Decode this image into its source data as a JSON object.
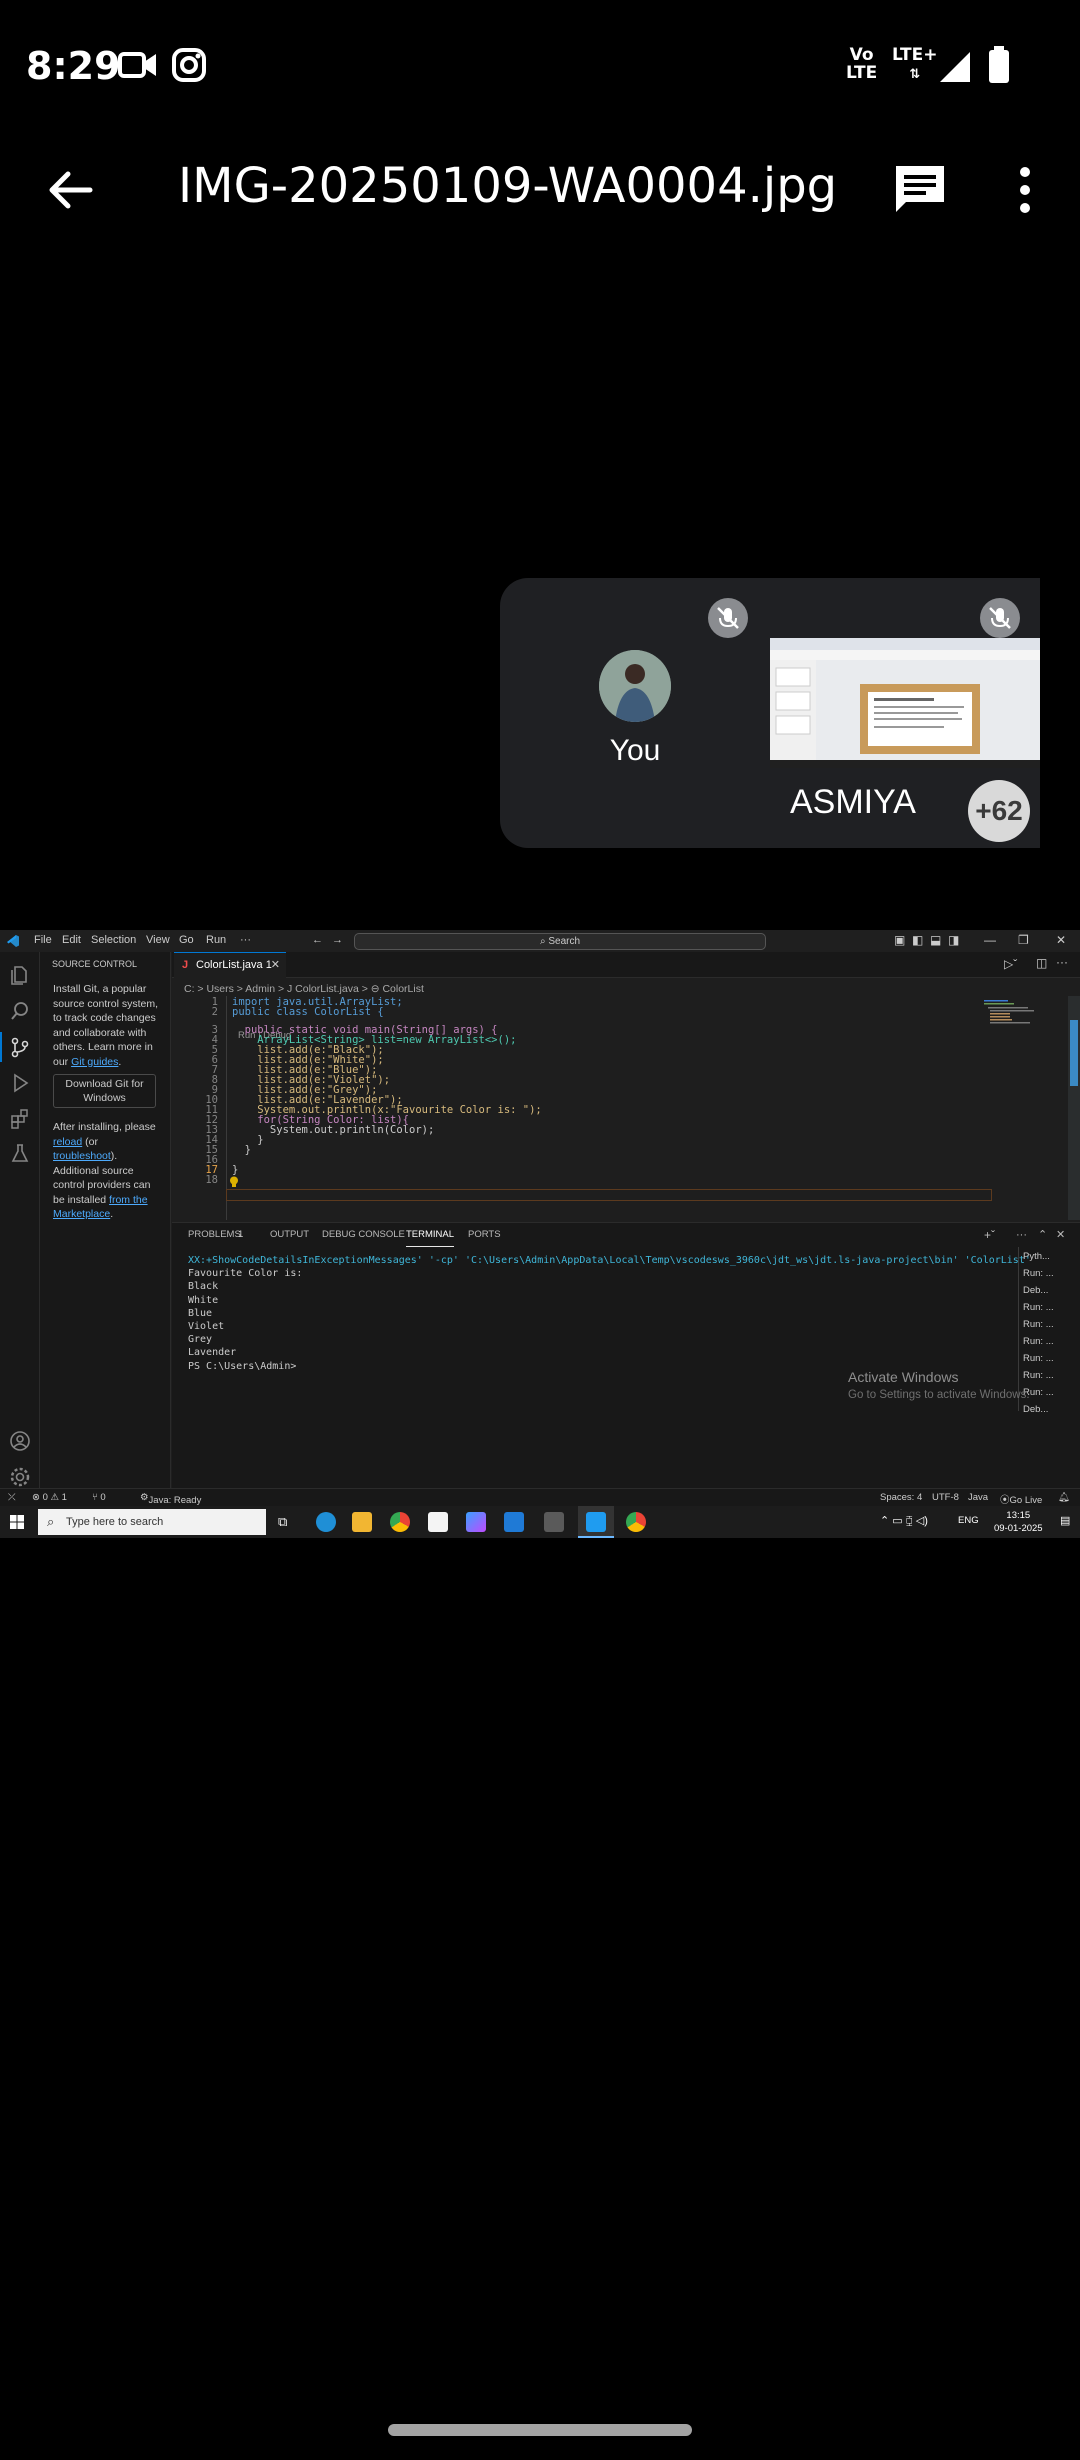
{
  "status_bar": {
    "time": "8:29",
    "net1": "Vo\nLTE",
    "net2": "LTE+"
  },
  "toolbar": {
    "title": "IMG-20250109-WA0004.jpg"
  },
  "meet": {
    "self_name": "You",
    "other_name": "ASMIYA",
    "more_count": "+62"
  },
  "vscode": {
    "menu": [
      "File",
      "Edit",
      "Selection",
      "View",
      "Go",
      "Run",
      "···"
    ],
    "search": "Search",
    "sidebar": {
      "header": "SOURCE CONTROL",
      "intro_a": "Install Git, a popular source control system, to track code changes and collaborate with others. Learn more in our ",
      "intro_link": "Git guides",
      "intro_b": ".",
      "download_button": "Download Git for Windows",
      "after_a": "After installing, please ",
      "after_link1": "reload",
      "after_b": " (or ",
      "after_link2": "troubleshoot",
      "after_c": "). Additional source control providers can be installed ",
      "after_link3": "from the Marketplace",
      "after_d": "."
    },
    "tab_label": "ColorList.java 1",
    "breadcrumb": "C: > Users > Admin > J ColorList.java > ⊖ ColorList",
    "codelens": "Run | Debug",
    "lines": [
      {
        "n": "1",
        "code": "import java.util.ArrayList;"
      },
      {
        "n": "2",
        "code": "public class ColorList {"
      },
      {
        "n": "3",
        "code": "  public static void main(String[] args) {"
      },
      {
        "n": "4",
        "code": "    ArrayList<String> list=new ArrayList<>();"
      },
      {
        "n": "5",
        "code": "    list.add(e:\"Black\");"
      },
      {
        "n": "6",
        "code": "    list.add(e:\"White\");"
      },
      {
        "n": "7",
        "code": "    list.add(e:\"Blue\");"
      },
      {
        "n": "8",
        "code": "    list.add(e:\"Violet\");"
      },
      {
        "n": "9",
        "code": "    list.add(e:\"Grey\");"
      },
      {
        "n": "10",
        "code": "    list.add(e:\"Lavender\");"
      },
      {
        "n": "11",
        "code": "    System.out.println(x:\"Favourite Color is: \");"
      },
      {
        "n": "12",
        "code": "    for(String Color: list){"
      },
      {
        "n": "13",
        "code": "      System.out.println(Color);"
      },
      {
        "n": "14",
        "code": "    }"
      },
      {
        "n": "15",
        "code": "  }"
      },
      {
        "n": "16",
        "code": ""
      },
      {
        "n": "17",
        "code": "}"
      },
      {
        "n": "18",
        "code": ""
      }
    ],
    "panel_tabs": [
      "PROBLEMS",
      "1",
      "OUTPUT",
      "DEBUG CONSOLE",
      "TERMINAL",
      "PORTS"
    ],
    "terminal": [
      "XX:+ShowCodeDetailsInExceptionMessages' '-cp' 'C:\\Users\\Admin\\AppData\\Local\\Temp\\vscodesws_3960c\\jdt_ws\\jdt.ls-java-project\\bin' 'ColorList'",
      "Favourite Color is:",
      "Black",
      "White",
      "Blue",
      "Violet",
      "Grey",
      "Lavender",
      "PS C:\\Users\\Admin>"
    ],
    "terminal_list": [
      "Pyth...",
      "Run: ...",
      "Deb...",
      "Run: ...",
      "Run: ...",
      "Run: ...",
      "Run: ...",
      "Run: ...",
      "Run: ...",
      "Deb..."
    ],
    "activate_title": "Activate Windows",
    "activate_sub": "Go to Settings to activate Windows.",
    "status_left": [
      "⊗ 0 ⚠ 1",
      "⑂ 0",
      "Java: Ready"
    ],
    "status_right": [
      "Spaces: 4",
      "UTF-8",
      "Java",
      "Go Live"
    ],
    "taskbar_search": "Type here to search",
    "lang": "ENG",
    "clock_time": "13:15",
    "clock_date": "09-01-2025"
  }
}
